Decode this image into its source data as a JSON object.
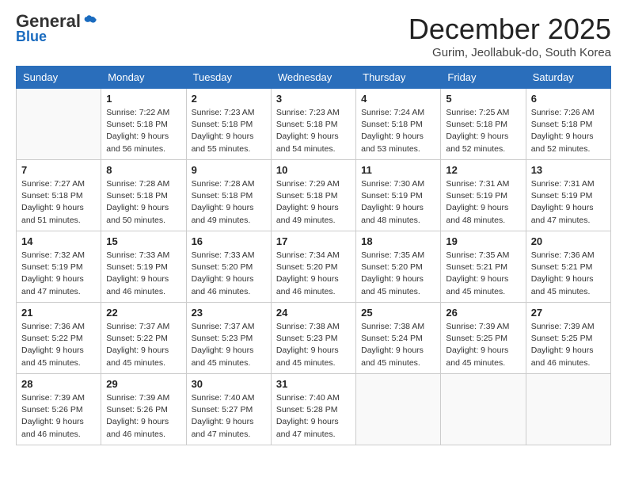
{
  "logo": {
    "general": "General",
    "blue": "Blue"
  },
  "header": {
    "month": "December 2025",
    "location": "Gurim, Jeollabuk-do, South Korea"
  },
  "days_of_week": [
    "Sunday",
    "Monday",
    "Tuesday",
    "Wednesday",
    "Thursday",
    "Friday",
    "Saturday"
  ],
  "weeks": [
    [
      {
        "day": "",
        "info": ""
      },
      {
        "day": "1",
        "info": "Sunrise: 7:22 AM\nSunset: 5:18 PM\nDaylight: 9 hours\nand 56 minutes."
      },
      {
        "day": "2",
        "info": "Sunrise: 7:23 AM\nSunset: 5:18 PM\nDaylight: 9 hours\nand 55 minutes."
      },
      {
        "day": "3",
        "info": "Sunrise: 7:23 AM\nSunset: 5:18 PM\nDaylight: 9 hours\nand 54 minutes."
      },
      {
        "day": "4",
        "info": "Sunrise: 7:24 AM\nSunset: 5:18 PM\nDaylight: 9 hours\nand 53 minutes."
      },
      {
        "day": "5",
        "info": "Sunrise: 7:25 AM\nSunset: 5:18 PM\nDaylight: 9 hours\nand 52 minutes."
      },
      {
        "day": "6",
        "info": "Sunrise: 7:26 AM\nSunset: 5:18 PM\nDaylight: 9 hours\nand 52 minutes."
      }
    ],
    [
      {
        "day": "7",
        "info": "Sunrise: 7:27 AM\nSunset: 5:18 PM\nDaylight: 9 hours\nand 51 minutes."
      },
      {
        "day": "8",
        "info": "Sunrise: 7:28 AM\nSunset: 5:18 PM\nDaylight: 9 hours\nand 50 minutes."
      },
      {
        "day": "9",
        "info": "Sunrise: 7:28 AM\nSunset: 5:18 PM\nDaylight: 9 hours\nand 49 minutes."
      },
      {
        "day": "10",
        "info": "Sunrise: 7:29 AM\nSunset: 5:18 PM\nDaylight: 9 hours\nand 49 minutes."
      },
      {
        "day": "11",
        "info": "Sunrise: 7:30 AM\nSunset: 5:19 PM\nDaylight: 9 hours\nand 48 minutes."
      },
      {
        "day": "12",
        "info": "Sunrise: 7:31 AM\nSunset: 5:19 PM\nDaylight: 9 hours\nand 48 minutes."
      },
      {
        "day": "13",
        "info": "Sunrise: 7:31 AM\nSunset: 5:19 PM\nDaylight: 9 hours\nand 47 minutes."
      }
    ],
    [
      {
        "day": "14",
        "info": "Sunrise: 7:32 AM\nSunset: 5:19 PM\nDaylight: 9 hours\nand 47 minutes."
      },
      {
        "day": "15",
        "info": "Sunrise: 7:33 AM\nSunset: 5:19 PM\nDaylight: 9 hours\nand 46 minutes."
      },
      {
        "day": "16",
        "info": "Sunrise: 7:33 AM\nSunset: 5:20 PM\nDaylight: 9 hours\nand 46 minutes."
      },
      {
        "day": "17",
        "info": "Sunrise: 7:34 AM\nSunset: 5:20 PM\nDaylight: 9 hours\nand 46 minutes."
      },
      {
        "day": "18",
        "info": "Sunrise: 7:35 AM\nSunset: 5:20 PM\nDaylight: 9 hours\nand 45 minutes."
      },
      {
        "day": "19",
        "info": "Sunrise: 7:35 AM\nSunset: 5:21 PM\nDaylight: 9 hours\nand 45 minutes."
      },
      {
        "day": "20",
        "info": "Sunrise: 7:36 AM\nSunset: 5:21 PM\nDaylight: 9 hours\nand 45 minutes."
      }
    ],
    [
      {
        "day": "21",
        "info": "Sunrise: 7:36 AM\nSunset: 5:22 PM\nDaylight: 9 hours\nand 45 minutes."
      },
      {
        "day": "22",
        "info": "Sunrise: 7:37 AM\nSunset: 5:22 PM\nDaylight: 9 hours\nand 45 minutes."
      },
      {
        "day": "23",
        "info": "Sunrise: 7:37 AM\nSunset: 5:23 PM\nDaylight: 9 hours\nand 45 minutes."
      },
      {
        "day": "24",
        "info": "Sunrise: 7:38 AM\nSunset: 5:23 PM\nDaylight: 9 hours\nand 45 minutes."
      },
      {
        "day": "25",
        "info": "Sunrise: 7:38 AM\nSunset: 5:24 PM\nDaylight: 9 hours\nand 45 minutes."
      },
      {
        "day": "26",
        "info": "Sunrise: 7:39 AM\nSunset: 5:25 PM\nDaylight: 9 hours\nand 45 minutes."
      },
      {
        "day": "27",
        "info": "Sunrise: 7:39 AM\nSunset: 5:25 PM\nDaylight: 9 hours\nand 46 minutes."
      }
    ],
    [
      {
        "day": "28",
        "info": "Sunrise: 7:39 AM\nSunset: 5:26 PM\nDaylight: 9 hours\nand 46 minutes."
      },
      {
        "day": "29",
        "info": "Sunrise: 7:39 AM\nSunset: 5:26 PM\nDaylight: 9 hours\nand 46 minutes."
      },
      {
        "day": "30",
        "info": "Sunrise: 7:40 AM\nSunset: 5:27 PM\nDaylight: 9 hours\nand 47 minutes."
      },
      {
        "day": "31",
        "info": "Sunrise: 7:40 AM\nSunset: 5:28 PM\nDaylight: 9 hours\nand 47 minutes."
      },
      {
        "day": "",
        "info": ""
      },
      {
        "day": "",
        "info": ""
      },
      {
        "day": "",
        "info": ""
      }
    ]
  ]
}
